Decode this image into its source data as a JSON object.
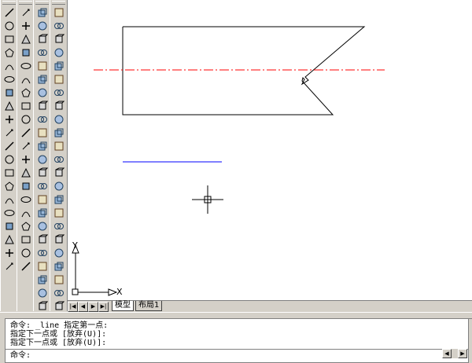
{
  "toolbars": {
    "draw": [
      "line-icon",
      "construction-line-icon",
      "polyline-icon",
      "polygon-icon",
      "rectangle-icon",
      "arc-icon",
      "circle-icon",
      "spline-icon",
      "ellipse-icon",
      "ellipse-arc-icon",
      "insert-block-icon",
      "make-block-icon",
      "point-icon",
      "hatch-icon",
      "gradient-icon",
      "region-icon",
      "table-icon",
      "mtext-icon",
      "text-icon",
      "toolbar-end-icon"
    ],
    "modify": [
      "erase-icon",
      "copy-icon",
      "mirror-icon",
      "offset-icon",
      "array-icon",
      "move-icon",
      "rotate-icon",
      "scale-icon",
      "stretch-icon",
      "trim-icon",
      "extend-icon",
      "break-icon",
      "join-icon",
      "chamfer-icon",
      "fillet-icon",
      "explode-icon",
      "dimension-icon",
      "text-style-icon",
      "leader-icon",
      "align-icon"
    ],
    "solids": [
      "box-icon",
      "sphere-icon",
      "cylinder-icon",
      "cone-icon",
      "wedge-icon",
      "torus-icon",
      "extrude-icon",
      "revolve-icon",
      "slice-icon",
      "section-icon",
      "interfere-icon",
      "setup-drawing-icon",
      "setup-view-icon",
      "setup-profile-icon",
      "3d-orbit-icon",
      "ucs-icon",
      "view-icon",
      "render-icon",
      "ucs-world-icon",
      "pan-icon",
      "text-a-icon",
      "text-edit-icon",
      "text-find-icon"
    ],
    "editing": [
      "union-icon",
      "subtract-icon",
      "intersect-icon",
      "extrude-faces-icon",
      "move-faces-icon",
      "offset-faces-icon",
      "delete-faces-icon",
      "rotate-faces-icon",
      "taper-faces-icon",
      "copy-faces-icon",
      "color-faces-icon",
      "copy-edges-icon",
      "color-edges-icon",
      "imprint-icon",
      "clean-icon",
      "separate-icon",
      "shell-icon",
      "check-icon",
      "pick-icon",
      "navigate-icon",
      "properties-icon",
      "layers-icon",
      "view-cube-icon"
    ]
  },
  "tabs": {
    "model": "模型",
    "layout1": "布局1"
  },
  "nav": {
    "first": "|◀",
    "prev": "◀",
    "next": "▶",
    "last": "▶|"
  },
  "ucs": {
    "x_label": "X",
    "y_label": "Y"
  },
  "command": {
    "history": [
      "命令: _line 指定第一点:",
      "指定下一点或 [放弃(U)]:",
      "指定下一点或 [放弃(U)]:"
    ],
    "prompt": "命令:"
  },
  "colors": {
    "canvas_bg": "#ffffff",
    "shape_stroke": "#000000",
    "centerline": "#ff0000",
    "blue_line": "#0000ff"
  }
}
